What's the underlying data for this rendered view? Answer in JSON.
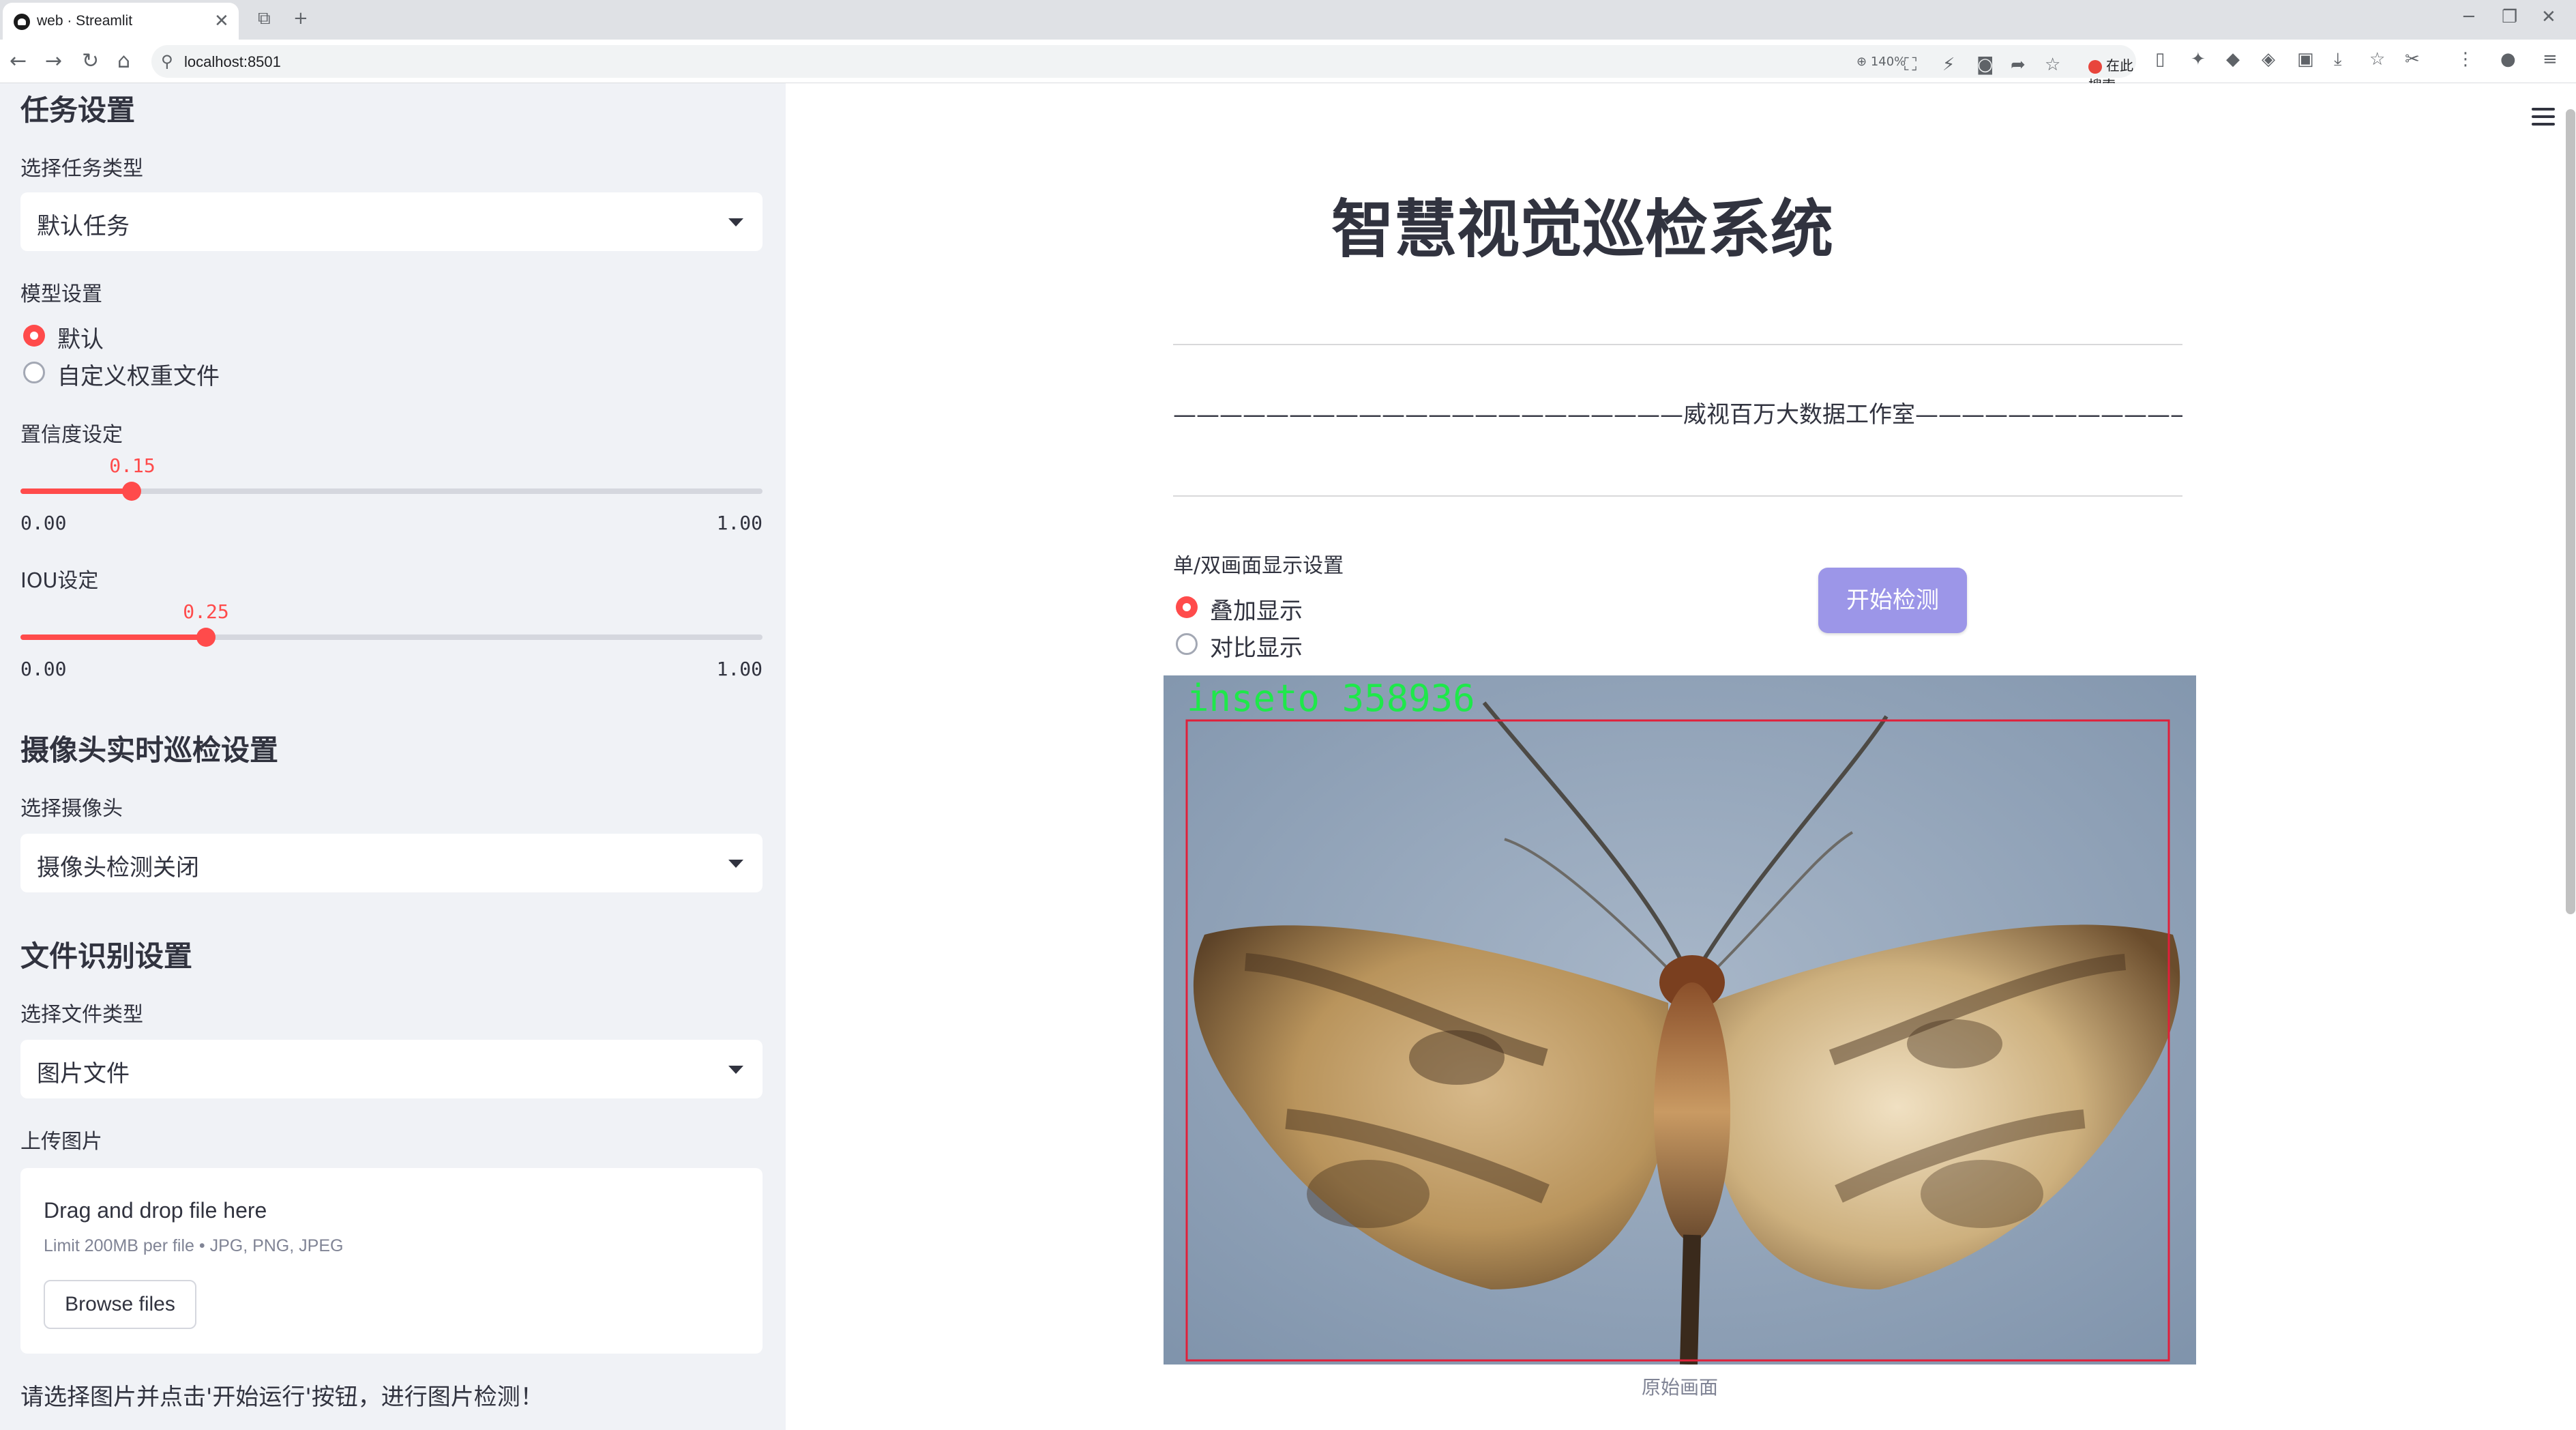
{
  "browser": {
    "tab_title": "web · Streamlit",
    "url": "localhost:8501",
    "zoom": "140%",
    "search_engine_label": "在此搜索"
  },
  "sidebar": {
    "task_section_title": "任务设置",
    "task_type_label": "选择任务类型",
    "task_type_value": "默认任务",
    "model_label": "模型设置",
    "model_options": [
      "默认",
      "自定义权重文件"
    ],
    "model_selected": "默认",
    "confidence_label": "置信度设定",
    "confidence": {
      "value": "0.15",
      "min": "0.00",
      "max": "1.00",
      "fraction": 0.15
    },
    "iou_label": "IOU设定",
    "iou": {
      "value": "0.25",
      "min": "0.00",
      "max": "1.00",
      "fraction": 0.25
    },
    "camera_section_title": "摄像头实时巡检设置",
    "camera_label": "选择摄像头",
    "camera_value": "摄像头检测关闭",
    "file_section_title": "文件识别设置",
    "file_type_label": "选择文件类型",
    "file_type_value": "图片文件",
    "upload_label": "上传图片",
    "upload_drag_text": "Drag and drop file here",
    "upload_limit_text": "Limit 200MB per file • JPG, PNG, JPEG",
    "browse_button": "Browse files",
    "hint_text": "请选择图片并点击'开始运行'按钮，进行图片检测！"
  },
  "main": {
    "title": "智慧视觉巡检系统",
    "subline": "——————————————————————威视百万大数据工作室——————————————————————",
    "display_label": "单/双画面显示设置",
    "display_options": [
      "叠加显示",
      "对比显示"
    ],
    "display_selected": "叠加显示",
    "start_button": "开始检测",
    "detection_label": "inseto 358936",
    "image_caption": "原始画面"
  },
  "colors": {
    "accent": "#ff4b4b",
    "sidebar_bg": "#f0f2f6",
    "button_primary": "#9c96e8",
    "detection_box": "#e0203a",
    "detection_text": "#1ee84a"
  }
}
